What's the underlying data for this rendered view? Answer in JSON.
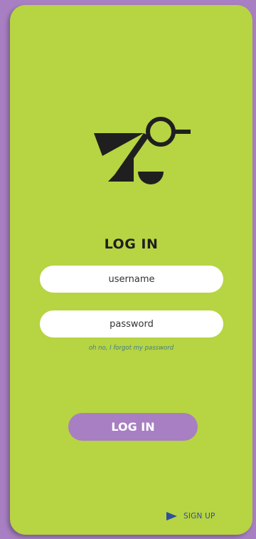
{
  "login": {
    "title": "LOG IN",
    "username_placeholder": "username",
    "password_placeholder": "password",
    "forgot_password_link": "oh no, I forgot my password",
    "submit_label": "LOG IN"
  },
  "signup": {
    "label": "SIGN UP",
    "icon": "play-triangle-icon"
  },
  "logo": {
    "icon": "scale-bird-logo-icon"
  },
  "colors": {
    "background": "#a77fc2",
    "card": "#b7d442",
    "field": "#ffffff",
    "button": "#a77fc2",
    "button_text": "#ffffff",
    "link": "#3f7f8a",
    "signup": "#2d4fa0",
    "text": "#1f1f1f"
  }
}
